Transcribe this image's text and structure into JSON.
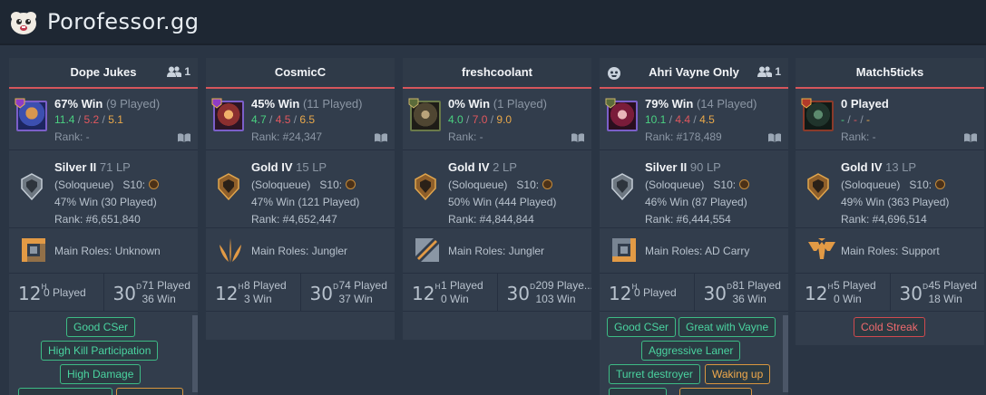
{
  "app": {
    "title": "Porofessor.gg"
  },
  "players": [
    {
      "name": "Dope Jukes",
      "premade": "1",
      "champ": {
        "winrate": "67% Win",
        "played": "(9 Played)",
        "k": "11.4",
        "d": "5.2",
        "a": "5.1",
        "rank": "Rank: -"
      },
      "solo": {
        "tier": "Silver II",
        "lp": "71 LP",
        "queue": "(Soloqueue)",
        "season": "S10:",
        "winrate": "47% Win (30 Played)",
        "rank": "Rank: #6,651,840"
      },
      "roles": "Main Roles: Unknown",
      "activity": {
        "h12": "0 Played",
        "d30_played": "71 Played",
        "d30_win": "36 Win"
      },
      "tags": [
        "Good CSer",
        "High Kill Participation",
        "High Damage"
      ]
    },
    {
      "name": "CosmicC",
      "premade": "",
      "champ": {
        "winrate": "45% Win",
        "played": "(11 Played)",
        "k": "4.7",
        "d": "4.5",
        "a": "6.5",
        "rank": "Rank: #24,347"
      },
      "solo": {
        "tier": "Gold IV",
        "lp": "15 LP",
        "queue": "(Soloqueue)",
        "season": "S10:",
        "winrate": "47% Win (121 Played)",
        "rank": "Rank: #4,652,447"
      },
      "roles": "Main Roles: Jungler",
      "activity": {
        "h12_played": "8 Played",
        "h12_win": "3 Win",
        "d30_played": "74 Played",
        "d30_win": "37 Win"
      },
      "tags": []
    },
    {
      "name": "freshcoolant",
      "premade": "",
      "champ": {
        "winrate": "0% Win",
        "played": "(1 Played)",
        "k": "4.0",
        "d": "7.0",
        "a": "9.0",
        "rank": "Rank: -"
      },
      "solo": {
        "tier": "Gold IV",
        "lp": "2 LP",
        "queue": "(Soloqueue)",
        "season": "S10:",
        "winrate": "50% Win (444 Played)",
        "rank": "Rank: #4,844,844"
      },
      "roles": "Main Roles: Jungler",
      "activity": {
        "h12_played": "1 Played",
        "h12_win": "0 Win",
        "d30_played": "209 Playe...",
        "d30_win": "103 Win"
      },
      "tags": []
    },
    {
      "name": "Ahri Vayne Only",
      "premade": "1",
      "champ": {
        "winrate": "79% Win",
        "played": "(14 Played)",
        "k": "10.1",
        "d": "4.4",
        "a": "4.5",
        "rank": "Rank: #178,489"
      },
      "solo": {
        "tier": "Silver II",
        "lp": "90 LP",
        "queue": "(Soloqueue)",
        "season": "S10:",
        "winrate": "46% Win (87 Played)",
        "rank": "Rank: #6,444,554"
      },
      "roles": "Main Roles: AD Carry",
      "activity": {
        "h12": "0 Played",
        "d30_played": "81 Played",
        "d30_win": "36 Win"
      },
      "tags": [
        "Good CSer",
        "Great with Vayne",
        "Aggressive Laner",
        "Turret destroyer",
        "Waking up"
      ]
    },
    {
      "name": "Match5ticks",
      "premade": "",
      "champ": {
        "winrate": "0 Played",
        "played": "",
        "k": "-",
        "d": "-",
        "a": "-",
        "rank": "Rank: -"
      },
      "solo": {
        "tier": "Gold IV",
        "lp": "13 LP",
        "queue": "(Soloqueue)",
        "season": "S10:",
        "winrate": "49% Win (363 Played)",
        "rank": "Rank: #4,696,514"
      },
      "roles": "Main Roles: Support",
      "activity": {
        "h12_played": "5 Played",
        "h12_win": "0 Win",
        "d30_played": "45 Played",
        "d30_win": "18 Win"
      },
      "tags": [
        "Cold Streak"
      ]
    }
  ],
  "activity_labels": {
    "h12": "12",
    "h12_unit": "H",
    "d30": "30",
    "d30_unit": "D"
  },
  "colors": {
    "tag_green": "#4ad4a0",
    "tag_orange": "#f0a94c",
    "tag_red": "#ef6a6e",
    "header_accent": "#d6565c"
  }
}
